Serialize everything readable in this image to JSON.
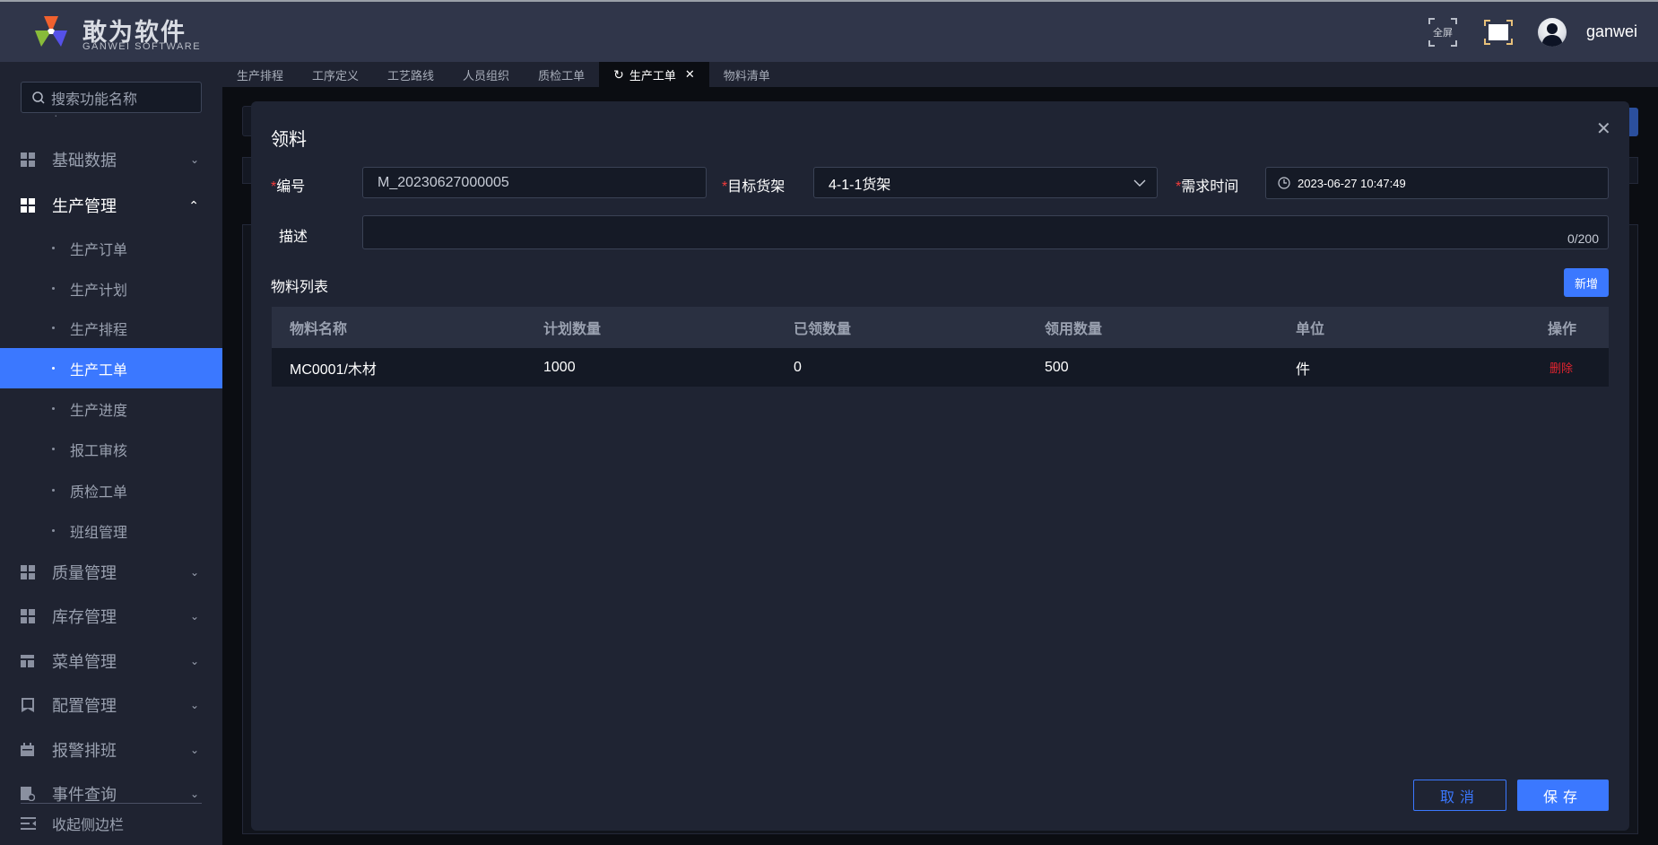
{
  "header": {
    "logo_cn": "敢为软件",
    "logo_en": "GANWEI SOFTWARE",
    "fullscreen_label": "全屏",
    "username": "ganwei"
  },
  "sidebar": {
    "search_placeholder": "搜索功能名称",
    "groups": [
      {
        "label": "基础数据",
        "icon": "grid-icon"
      },
      {
        "label": "生产管理",
        "icon": "grid-icon",
        "open": true
      },
      {
        "label": "质量管理",
        "icon": "grid-icon"
      },
      {
        "label": "库存管理",
        "icon": "grid-icon"
      },
      {
        "label": "菜单管理",
        "icon": "table-icon"
      },
      {
        "label": "配置管理",
        "icon": "bookmark-icon"
      },
      {
        "label": "报警排班",
        "icon": "calendar-icon"
      },
      {
        "label": "事件查询",
        "icon": "search-doc-icon"
      }
    ],
    "sub_items": [
      "生产订单",
      "生产计划",
      "生产排程",
      "生产工单",
      "生产进度",
      "报工审核",
      "质检工单",
      "班组管理"
    ],
    "active_sub": "生产工单",
    "collapse_label": "收起侧边栏"
  },
  "tabs": [
    {
      "label": "生产排程"
    },
    {
      "label": "工序定义"
    },
    {
      "label": "工艺路线"
    },
    {
      "label": "人员组织"
    },
    {
      "label": "质检工单"
    },
    {
      "label": "生产工单",
      "active": true
    },
    {
      "label": "物料清单"
    }
  ],
  "dialog": {
    "title": "领料",
    "fields": {
      "code_label": "编号",
      "code_value": "M_20230627000005",
      "shelf_label": "目标货架",
      "shelf_value": "4-1-1货架",
      "time_label": "需求时间",
      "time_value": "2023-06-27 10:47:49",
      "desc_label": "描述",
      "desc_counter": "0/200",
      "required_mark": "*"
    },
    "list_title": "物料列表",
    "add_label": "新增",
    "table": {
      "columns": [
        "物料名称",
        "计划数量",
        "已领数量",
        "领用数量",
        "单位",
        "操作"
      ],
      "rows": [
        {
          "name": "MC0001/木材",
          "planned": "1000",
          "received": "0",
          "requested": "500",
          "unit": "件",
          "action": "删除"
        }
      ]
    },
    "cancel_label": "取消",
    "save_label": "保存"
  },
  "colors": {
    "accent": "#3b78ff",
    "danger": "#e0242f"
  }
}
